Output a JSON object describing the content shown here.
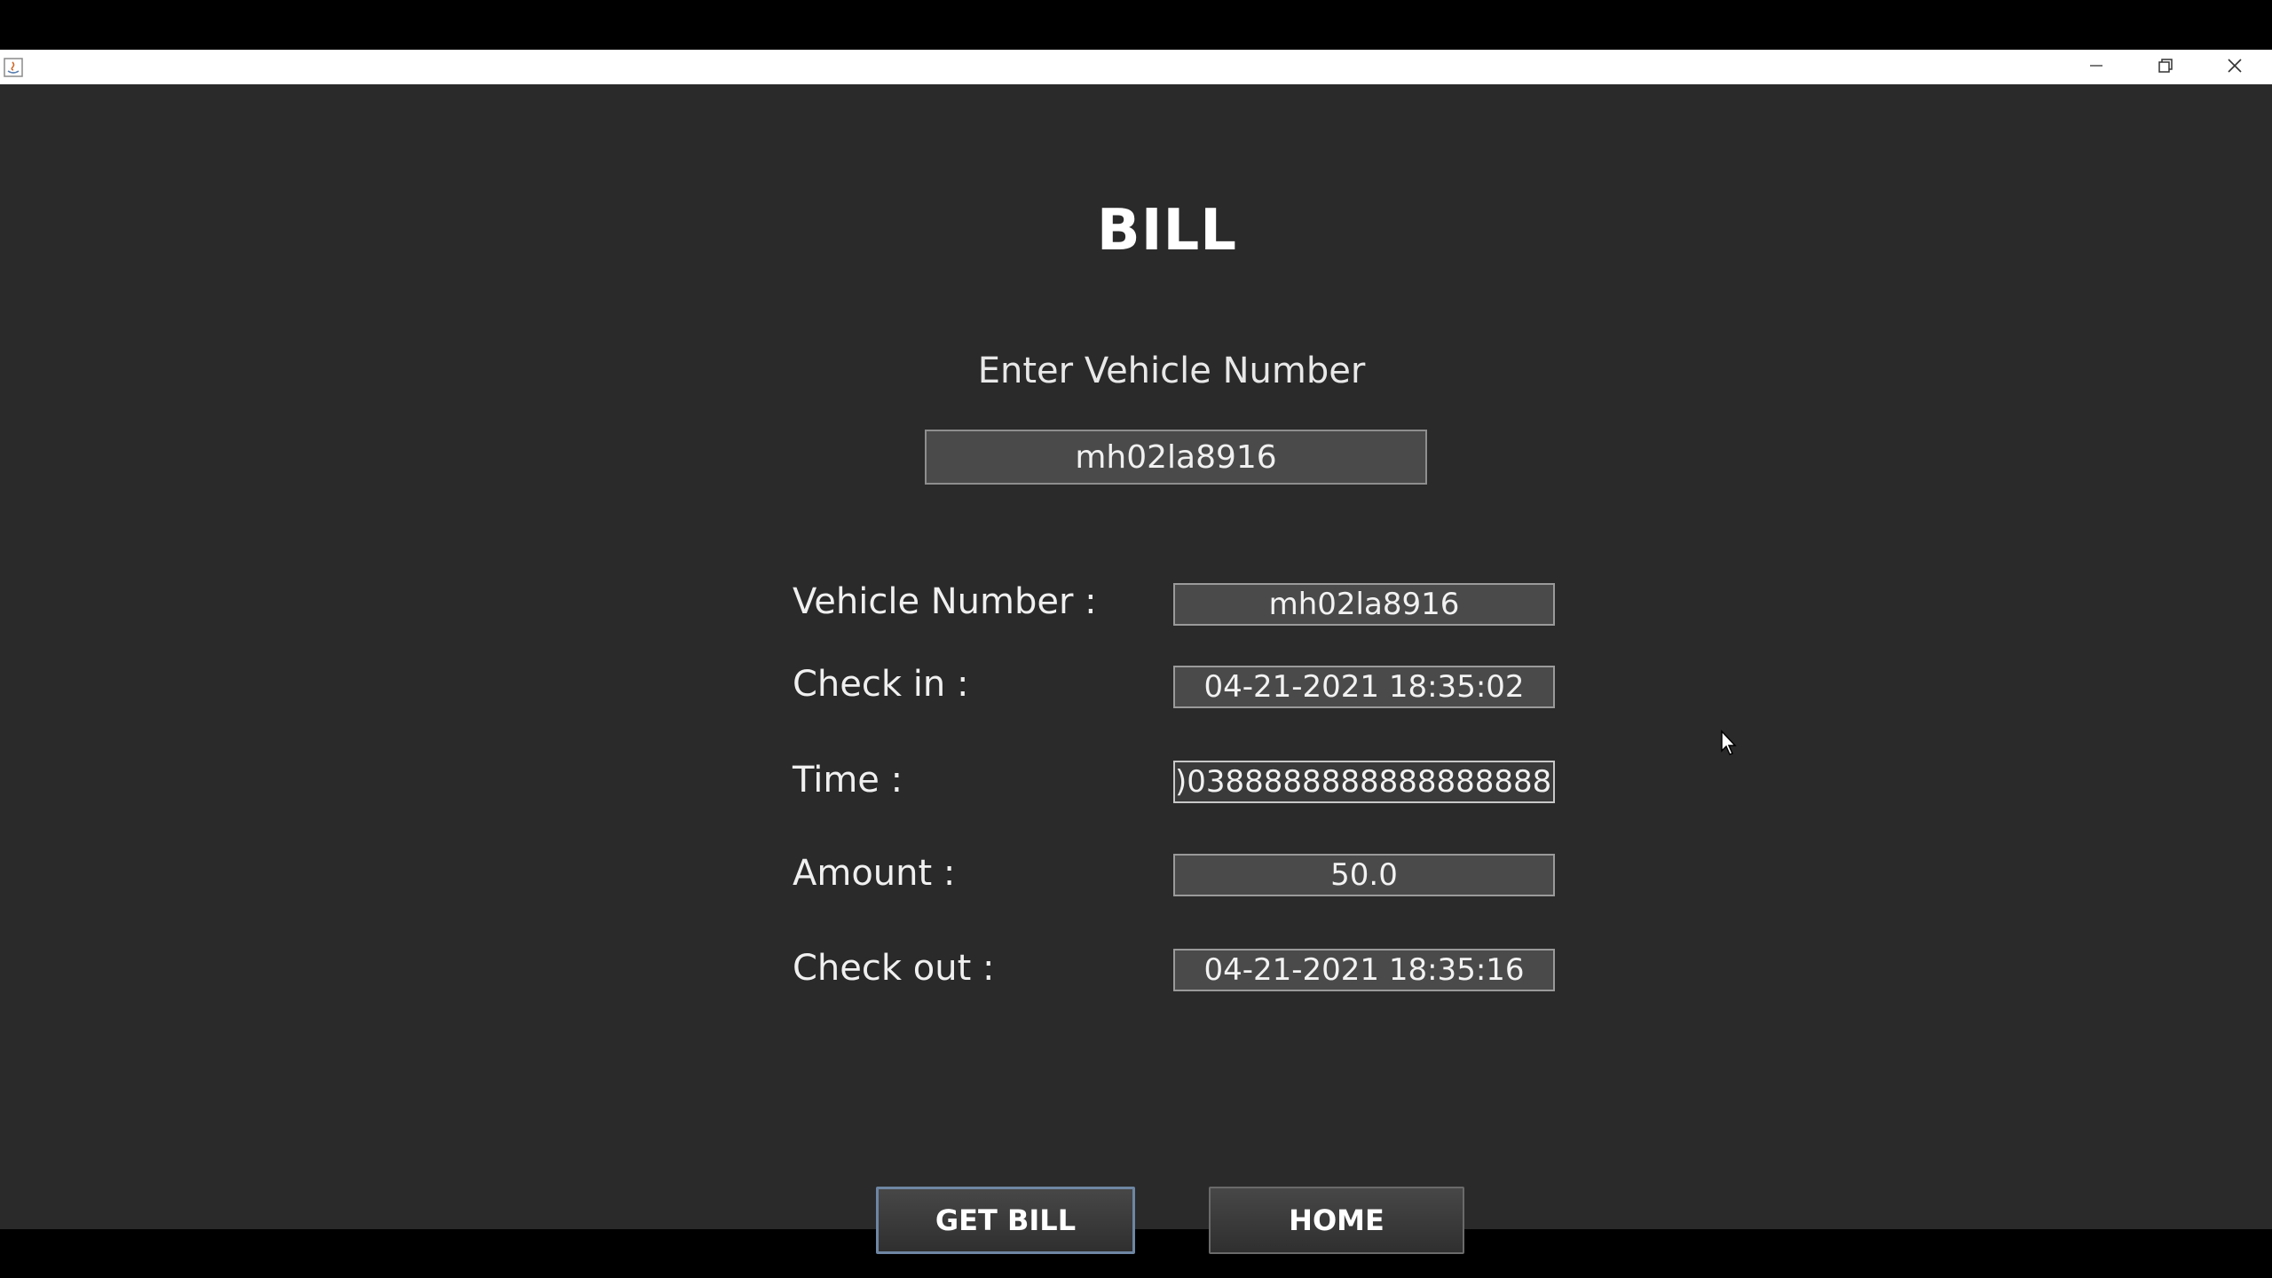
{
  "window": {
    "app_icon": "java-icon",
    "controls": {
      "minimize": "minimize-icon",
      "maximize": "restore-icon",
      "close": "close-icon"
    }
  },
  "page": {
    "title": "BILL",
    "vehicle_prompt": "Enter Vehicle Number",
    "vehicle_input_value": "mh02la8916"
  },
  "details": {
    "vehicle_number_label": "Vehicle Number :",
    "vehicle_number_value": "mh02la8916",
    "check_in_label": "Check in :",
    "check_in_value": "04-21-2021 18:35:02",
    "time_label": "Time :",
    "time_value": ")03888888888888888888",
    "amount_label": "Amount :",
    "amount_value": "50.0",
    "check_out_label": "Check out :",
    "check_out_value": "04-21-2021 18:35:16"
  },
  "actions": {
    "get_bill_label": "GET BILL",
    "home_label": "HOME"
  },
  "colors": {
    "background": "#2a2a2a",
    "field_bg": "#4a4a4a",
    "focus_border": "#6e86a3"
  }
}
